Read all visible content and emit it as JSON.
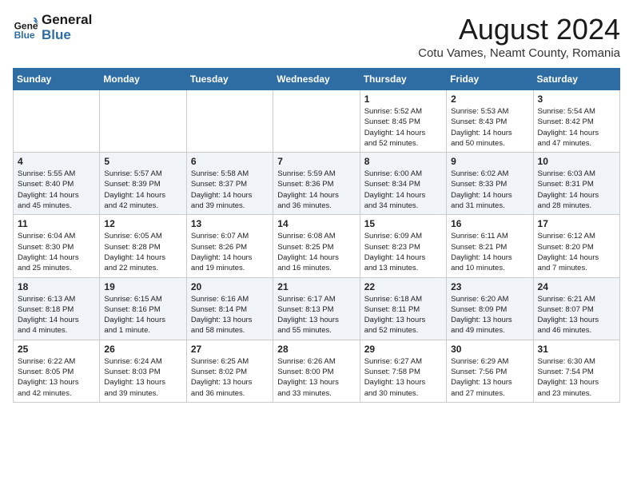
{
  "header": {
    "logo_line1": "General",
    "logo_line2": "Blue",
    "month_year": "August 2024",
    "location": "Cotu Vames, Neamt County, Romania"
  },
  "weekdays": [
    "Sunday",
    "Monday",
    "Tuesday",
    "Wednesday",
    "Thursday",
    "Friday",
    "Saturday"
  ],
  "weeks": [
    [
      {
        "day": "",
        "info": ""
      },
      {
        "day": "",
        "info": ""
      },
      {
        "day": "",
        "info": ""
      },
      {
        "day": "",
        "info": ""
      },
      {
        "day": "1",
        "info": "Sunrise: 5:52 AM\nSunset: 8:45 PM\nDaylight: 14 hours\nand 52 minutes."
      },
      {
        "day": "2",
        "info": "Sunrise: 5:53 AM\nSunset: 8:43 PM\nDaylight: 14 hours\nand 50 minutes."
      },
      {
        "day": "3",
        "info": "Sunrise: 5:54 AM\nSunset: 8:42 PM\nDaylight: 14 hours\nand 47 minutes."
      }
    ],
    [
      {
        "day": "4",
        "info": "Sunrise: 5:55 AM\nSunset: 8:40 PM\nDaylight: 14 hours\nand 45 minutes."
      },
      {
        "day": "5",
        "info": "Sunrise: 5:57 AM\nSunset: 8:39 PM\nDaylight: 14 hours\nand 42 minutes."
      },
      {
        "day": "6",
        "info": "Sunrise: 5:58 AM\nSunset: 8:37 PM\nDaylight: 14 hours\nand 39 minutes."
      },
      {
        "day": "7",
        "info": "Sunrise: 5:59 AM\nSunset: 8:36 PM\nDaylight: 14 hours\nand 36 minutes."
      },
      {
        "day": "8",
        "info": "Sunrise: 6:00 AM\nSunset: 8:34 PM\nDaylight: 14 hours\nand 34 minutes."
      },
      {
        "day": "9",
        "info": "Sunrise: 6:02 AM\nSunset: 8:33 PM\nDaylight: 14 hours\nand 31 minutes."
      },
      {
        "day": "10",
        "info": "Sunrise: 6:03 AM\nSunset: 8:31 PM\nDaylight: 14 hours\nand 28 minutes."
      }
    ],
    [
      {
        "day": "11",
        "info": "Sunrise: 6:04 AM\nSunset: 8:30 PM\nDaylight: 14 hours\nand 25 minutes."
      },
      {
        "day": "12",
        "info": "Sunrise: 6:05 AM\nSunset: 8:28 PM\nDaylight: 14 hours\nand 22 minutes."
      },
      {
        "day": "13",
        "info": "Sunrise: 6:07 AM\nSunset: 8:26 PM\nDaylight: 14 hours\nand 19 minutes."
      },
      {
        "day": "14",
        "info": "Sunrise: 6:08 AM\nSunset: 8:25 PM\nDaylight: 14 hours\nand 16 minutes."
      },
      {
        "day": "15",
        "info": "Sunrise: 6:09 AM\nSunset: 8:23 PM\nDaylight: 14 hours\nand 13 minutes."
      },
      {
        "day": "16",
        "info": "Sunrise: 6:11 AM\nSunset: 8:21 PM\nDaylight: 14 hours\nand 10 minutes."
      },
      {
        "day": "17",
        "info": "Sunrise: 6:12 AM\nSunset: 8:20 PM\nDaylight: 14 hours\nand 7 minutes."
      }
    ],
    [
      {
        "day": "18",
        "info": "Sunrise: 6:13 AM\nSunset: 8:18 PM\nDaylight: 14 hours\nand 4 minutes."
      },
      {
        "day": "19",
        "info": "Sunrise: 6:15 AM\nSunset: 8:16 PM\nDaylight: 14 hours\nand 1 minute."
      },
      {
        "day": "20",
        "info": "Sunrise: 6:16 AM\nSunset: 8:14 PM\nDaylight: 13 hours\nand 58 minutes."
      },
      {
        "day": "21",
        "info": "Sunrise: 6:17 AM\nSunset: 8:13 PM\nDaylight: 13 hours\nand 55 minutes."
      },
      {
        "day": "22",
        "info": "Sunrise: 6:18 AM\nSunset: 8:11 PM\nDaylight: 13 hours\nand 52 minutes."
      },
      {
        "day": "23",
        "info": "Sunrise: 6:20 AM\nSunset: 8:09 PM\nDaylight: 13 hours\nand 49 minutes."
      },
      {
        "day": "24",
        "info": "Sunrise: 6:21 AM\nSunset: 8:07 PM\nDaylight: 13 hours\nand 46 minutes."
      }
    ],
    [
      {
        "day": "25",
        "info": "Sunrise: 6:22 AM\nSunset: 8:05 PM\nDaylight: 13 hours\nand 42 minutes."
      },
      {
        "day": "26",
        "info": "Sunrise: 6:24 AM\nSunset: 8:03 PM\nDaylight: 13 hours\nand 39 minutes."
      },
      {
        "day": "27",
        "info": "Sunrise: 6:25 AM\nSunset: 8:02 PM\nDaylight: 13 hours\nand 36 minutes."
      },
      {
        "day": "28",
        "info": "Sunrise: 6:26 AM\nSunset: 8:00 PM\nDaylight: 13 hours\nand 33 minutes."
      },
      {
        "day": "29",
        "info": "Sunrise: 6:27 AM\nSunset: 7:58 PM\nDaylight: 13 hours\nand 30 minutes."
      },
      {
        "day": "30",
        "info": "Sunrise: 6:29 AM\nSunset: 7:56 PM\nDaylight: 13 hours\nand 27 minutes."
      },
      {
        "day": "31",
        "info": "Sunrise: 6:30 AM\nSunset: 7:54 PM\nDaylight: 13 hours\nand 23 minutes."
      }
    ]
  ]
}
